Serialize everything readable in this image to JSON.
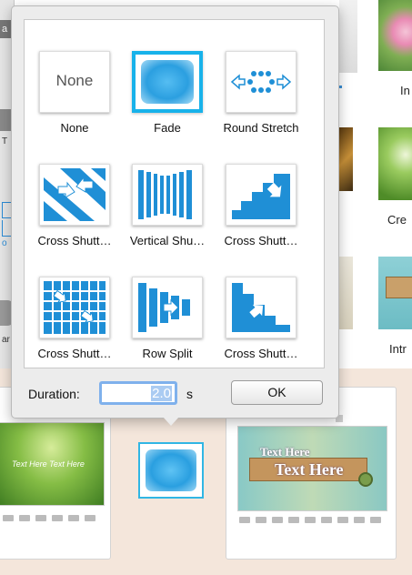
{
  "left_strip": {
    "tab_text": "a E",
    "glyph_t": "T",
    "glyph_o": "o",
    "glyph_ar": "ar"
  },
  "right_column": {
    "labels": [
      "In",
      "Cre",
      "Intr"
    ]
  },
  "film_slide_1": {
    "caption_line": "Text Here Text Here"
  },
  "film_slide_2": {
    "line1": "Text Here",
    "line2": "Text Here"
  },
  "transition_popover": {
    "transitions": [
      {
        "label": "None",
        "icon": "none-text-icon",
        "tile_text": "None",
        "selected": false
      },
      {
        "label": "Fade",
        "icon": "fade-icon",
        "selected": true
      },
      {
        "label": "Round Stretch",
        "icon": "round-stretch-icon",
        "selected": false
      },
      {
        "label": "Cross Shutt…",
        "icon": "cross-shutter-diagonal-icon",
        "selected": false
      },
      {
        "label": "Vertical Shu…",
        "icon": "vertical-shutter-icon",
        "selected": false
      },
      {
        "label": "Cross Shutt…",
        "icon": "cross-shutter-stairs-icon",
        "selected": false
      },
      {
        "label": "Cross Shutt…",
        "icon": "cross-shutter-grid-icon",
        "selected": false
      },
      {
        "label": "Row Split",
        "icon": "row-split-icon",
        "selected": false
      },
      {
        "label": "Cross Shutt…",
        "icon": "cross-shutter-stairs-down-icon",
        "selected": false
      }
    ],
    "duration_label": "Duration:",
    "duration_value": "2.0",
    "duration_unit": "s",
    "ok_label": "OK"
  },
  "colors": {
    "accent": "#18b2ea",
    "icon_blue": "#1f8fd6",
    "background": "#f4e6db"
  }
}
